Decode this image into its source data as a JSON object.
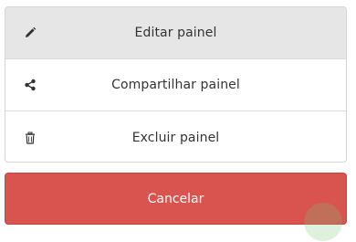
{
  "action_sheet": {
    "items": [
      {
        "label": "Editar painel",
        "icon": "pencil-icon",
        "active": true
      },
      {
        "label": "Compartilhar painel",
        "icon": "share-icon",
        "active": false
      },
      {
        "label": "Excluir painel",
        "icon": "trash-icon",
        "active": false
      }
    ]
  },
  "cancel": {
    "label": "Cancelar",
    "color": "#d9534f"
  },
  "colors": {
    "active_row_bg": "#e6e6e6",
    "text": "#333333",
    "border": "#d4d4d4"
  }
}
